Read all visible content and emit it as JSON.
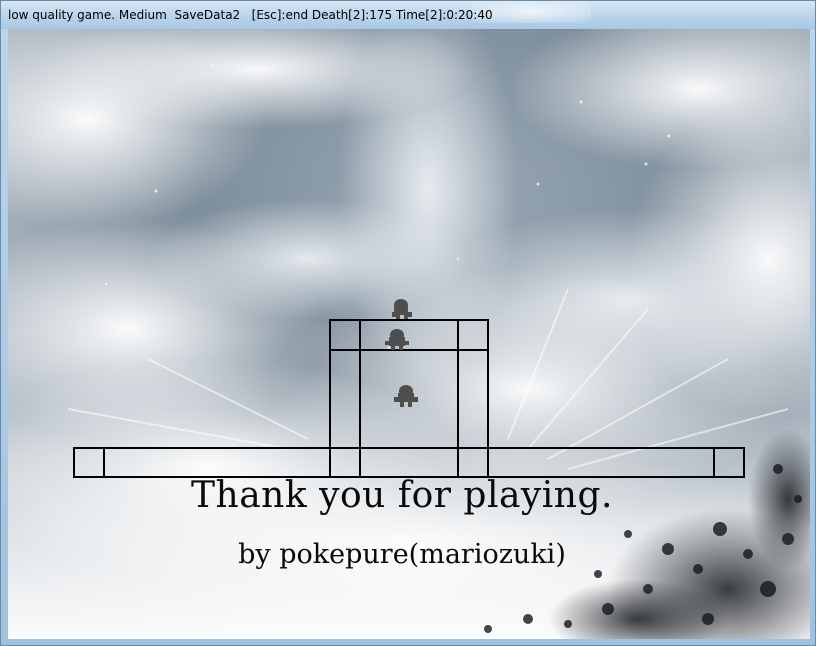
{
  "window": {
    "title": "low quality game. Medium  SaveData2   [Esc]:end Death[2]:175 Time[2]:0:20:40"
  },
  "game": {
    "ending_message": "Thank you for playing.",
    "credit": "by pokepure(mariozuki)"
  },
  "colors": {
    "outline": "#000000",
    "character": "#5a5a5a",
    "text": "#0a0a0a"
  }
}
